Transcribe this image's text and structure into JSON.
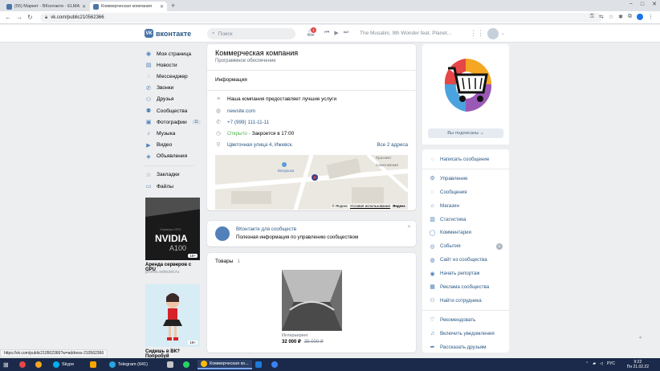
{
  "browser": {
    "tabs": [
      {
        "title": "(55) Маркет · ВКонтакте · ELMA"
      },
      {
        "title": "Коммерческая компания"
      }
    ],
    "new_tab": "+",
    "url": "vk.com/public210562366",
    "window_controls": [
      "−",
      "□",
      "✕"
    ]
  },
  "header": {
    "logo_text": "вконтакте",
    "search_placeholder": "Поиск",
    "notifications_count": "1",
    "now_playing": "The Musalini, 9th Wonder feat. Planet..."
  },
  "left_menu": {
    "items": [
      {
        "label": "Моя страница",
        "icon": "user-icon"
      },
      {
        "label": "Новости",
        "icon": "news-icon"
      },
      {
        "label": "Мессенджер",
        "icon": "chat-icon"
      },
      {
        "label": "Звонки",
        "icon": "phone-icon"
      },
      {
        "label": "Друзья",
        "icon": "friends-icon"
      },
      {
        "label": "Сообщества",
        "icon": "community-icon"
      },
      {
        "label": "Фотографии",
        "icon": "photo-icon",
        "count": "11"
      },
      {
        "label": "Музыка",
        "icon": "music-icon"
      },
      {
        "label": "Видео",
        "icon": "video-icon"
      },
      {
        "label": "Объявления",
        "icon": "classified-icon"
      }
    ],
    "items2": [
      {
        "label": "Закладки",
        "icon": "star-icon"
      },
      {
        "label": "Файлы",
        "icon": "file-icon"
      }
    ]
  },
  "ads": [
    {
      "title": "Аренда серверов с GPU",
      "domain": "promo.selectel.ru",
      "brand": "NVIDIA",
      "model": "A100",
      "caption": "Серверы GPU",
      "age": "18+"
    },
    {
      "title": "Сидишь в ВК? Попробуй",
      "age": "18+"
    }
  ],
  "community": {
    "name": "Коммерческая компания",
    "category": "Программное обеспечение",
    "info_header": "Информация",
    "description": "Наша компания предоставляет лучшие услуги",
    "website": "newsite.com",
    "phone": "+7 (999) 111-11-11",
    "open_status": "Открыто",
    "closes": "· Закроется в 17:00",
    "address": "Цветочная улица 4, Ижевск.",
    "all_addresses": "Все 2 адреса",
    "map_labels": {
      "street1": "Проспект",
      "street2": "Салютовская",
      "poi": "Ватрушка",
      "copyright": "© Яндекс",
      "terms": "Условия использования",
      "yandex": "Яндекс"
    }
  },
  "promo": {
    "title": "ВКонтакте для сообществ",
    "text": "Полезная информация по управлению сообществом",
    "close": "✕"
  },
  "products": {
    "header": "Товары",
    "count": "1",
    "item": {
      "name": "Интерьеринг",
      "price": "32 000 ₽",
      "old_price": "35 000 ₽"
    }
  },
  "right": {
    "subscribed_button": "Вы подписаны ⌄",
    "write_message": "Написать сообщение",
    "admin": [
      {
        "label": "Управление",
        "icon": "gear-icon"
      },
      {
        "label": "Сообщения",
        "icon": "message-icon"
      },
      {
        "label": "Магазин",
        "icon": "shop-icon"
      },
      {
        "label": "Статистика",
        "icon": "stats-icon"
      },
      {
        "label": "Комментарии",
        "icon": "comment-icon"
      },
      {
        "label": "События",
        "icon": "event-icon",
        "count": "3"
      },
      {
        "label": "Сайт из сообщества",
        "icon": "site-icon"
      },
      {
        "label": "Начать репортаж",
        "icon": "broadcast-icon"
      },
      {
        "label": "Реклама сообщества",
        "icon": "ads-icon"
      },
      {
        "label": "Найти сотрудника",
        "icon": "search-person-icon"
      }
    ],
    "actions": [
      {
        "label": "Рекомендовать",
        "icon": "like-icon"
      },
      {
        "label": "Включить уведомления",
        "icon": "bell-icon"
      },
      {
        "label": "Рассказать друзьям",
        "icon": "share-icon"
      }
    ]
  },
  "status_url": "https://vk.com/public210562366?w=address-210562366",
  "taskbar": {
    "items": [
      "Skype",
      "Telegram (641)",
      "Коммерческая ко..."
    ],
    "lang": "РУС",
    "time": "9:22",
    "date": "Пн 21.02.22"
  },
  "colors": {
    "vk_blue": "#4a76a8",
    "link": "#2a5885",
    "bg": "#edeef0"
  }
}
